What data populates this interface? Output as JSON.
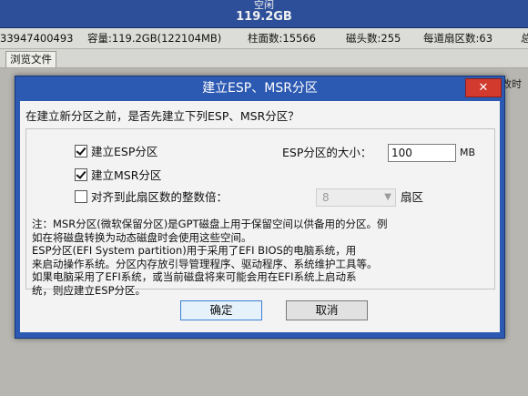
{
  "disk_strip": {
    "status": "空闲",
    "size": "119.2GB"
  },
  "info_bar": {
    "serial": "33947400493",
    "capacity": "容量:119.2GB(122104MB)",
    "cylinders": "柱面数:15566",
    "heads": "磁头数:255",
    "sectors": "每道扇区数:63",
    "extra": "总"
  },
  "tabs": [
    {
      "label": "浏览文件"
    }
  ],
  "background_label": "移改时",
  "dialog": {
    "title": "建立ESP、MSR分区",
    "close_label": "✕",
    "question": "在建立新分区之前，是否先建立下列ESP、MSR分区？",
    "options": {
      "esp": {
        "label": "建立ESP分区",
        "checked": true
      },
      "msr": {
        "label": "建立MSR分区",
        "checked": true
      },
      "align": {
        "label": "对齐到此扇区数的整数倍：",
        "checked": false
      }
    },
    "esp_size_label": "ESP分区的大小：",
    "esp_size_value": "100",
    "esp_size_unit": "MB",
    "align_value": "8",
    "align_unit": "扇区",
    "note_lines": [
      "注：MSR分区(微软保留分区)是GPT磁盘上用于保留空间以供备用的分区。例",
      "如在将磁盘转换为动态磁盘时会使用这些空间。",
      "    ESP分区(EFI System partition)用于采用了EFI BIOS的电脑系统，用",
      "来启动操作系统。分区内存放引导管理程序、驱动程序、系统维护工具等。",
      "    如果电脑采用了EFI系统，或当前磁盘将来可能会用在EFI系统上启动系",
      "统，则应建立ESP分区。"
    ],
    "ok_label": "确定",
    "cancel_label": "取消"
  },
  "colors": {
    "title_bar": "#2c59b2",
    "close_button": "#d23a2e",
    "client": "#f3f3f3"
  }
}
